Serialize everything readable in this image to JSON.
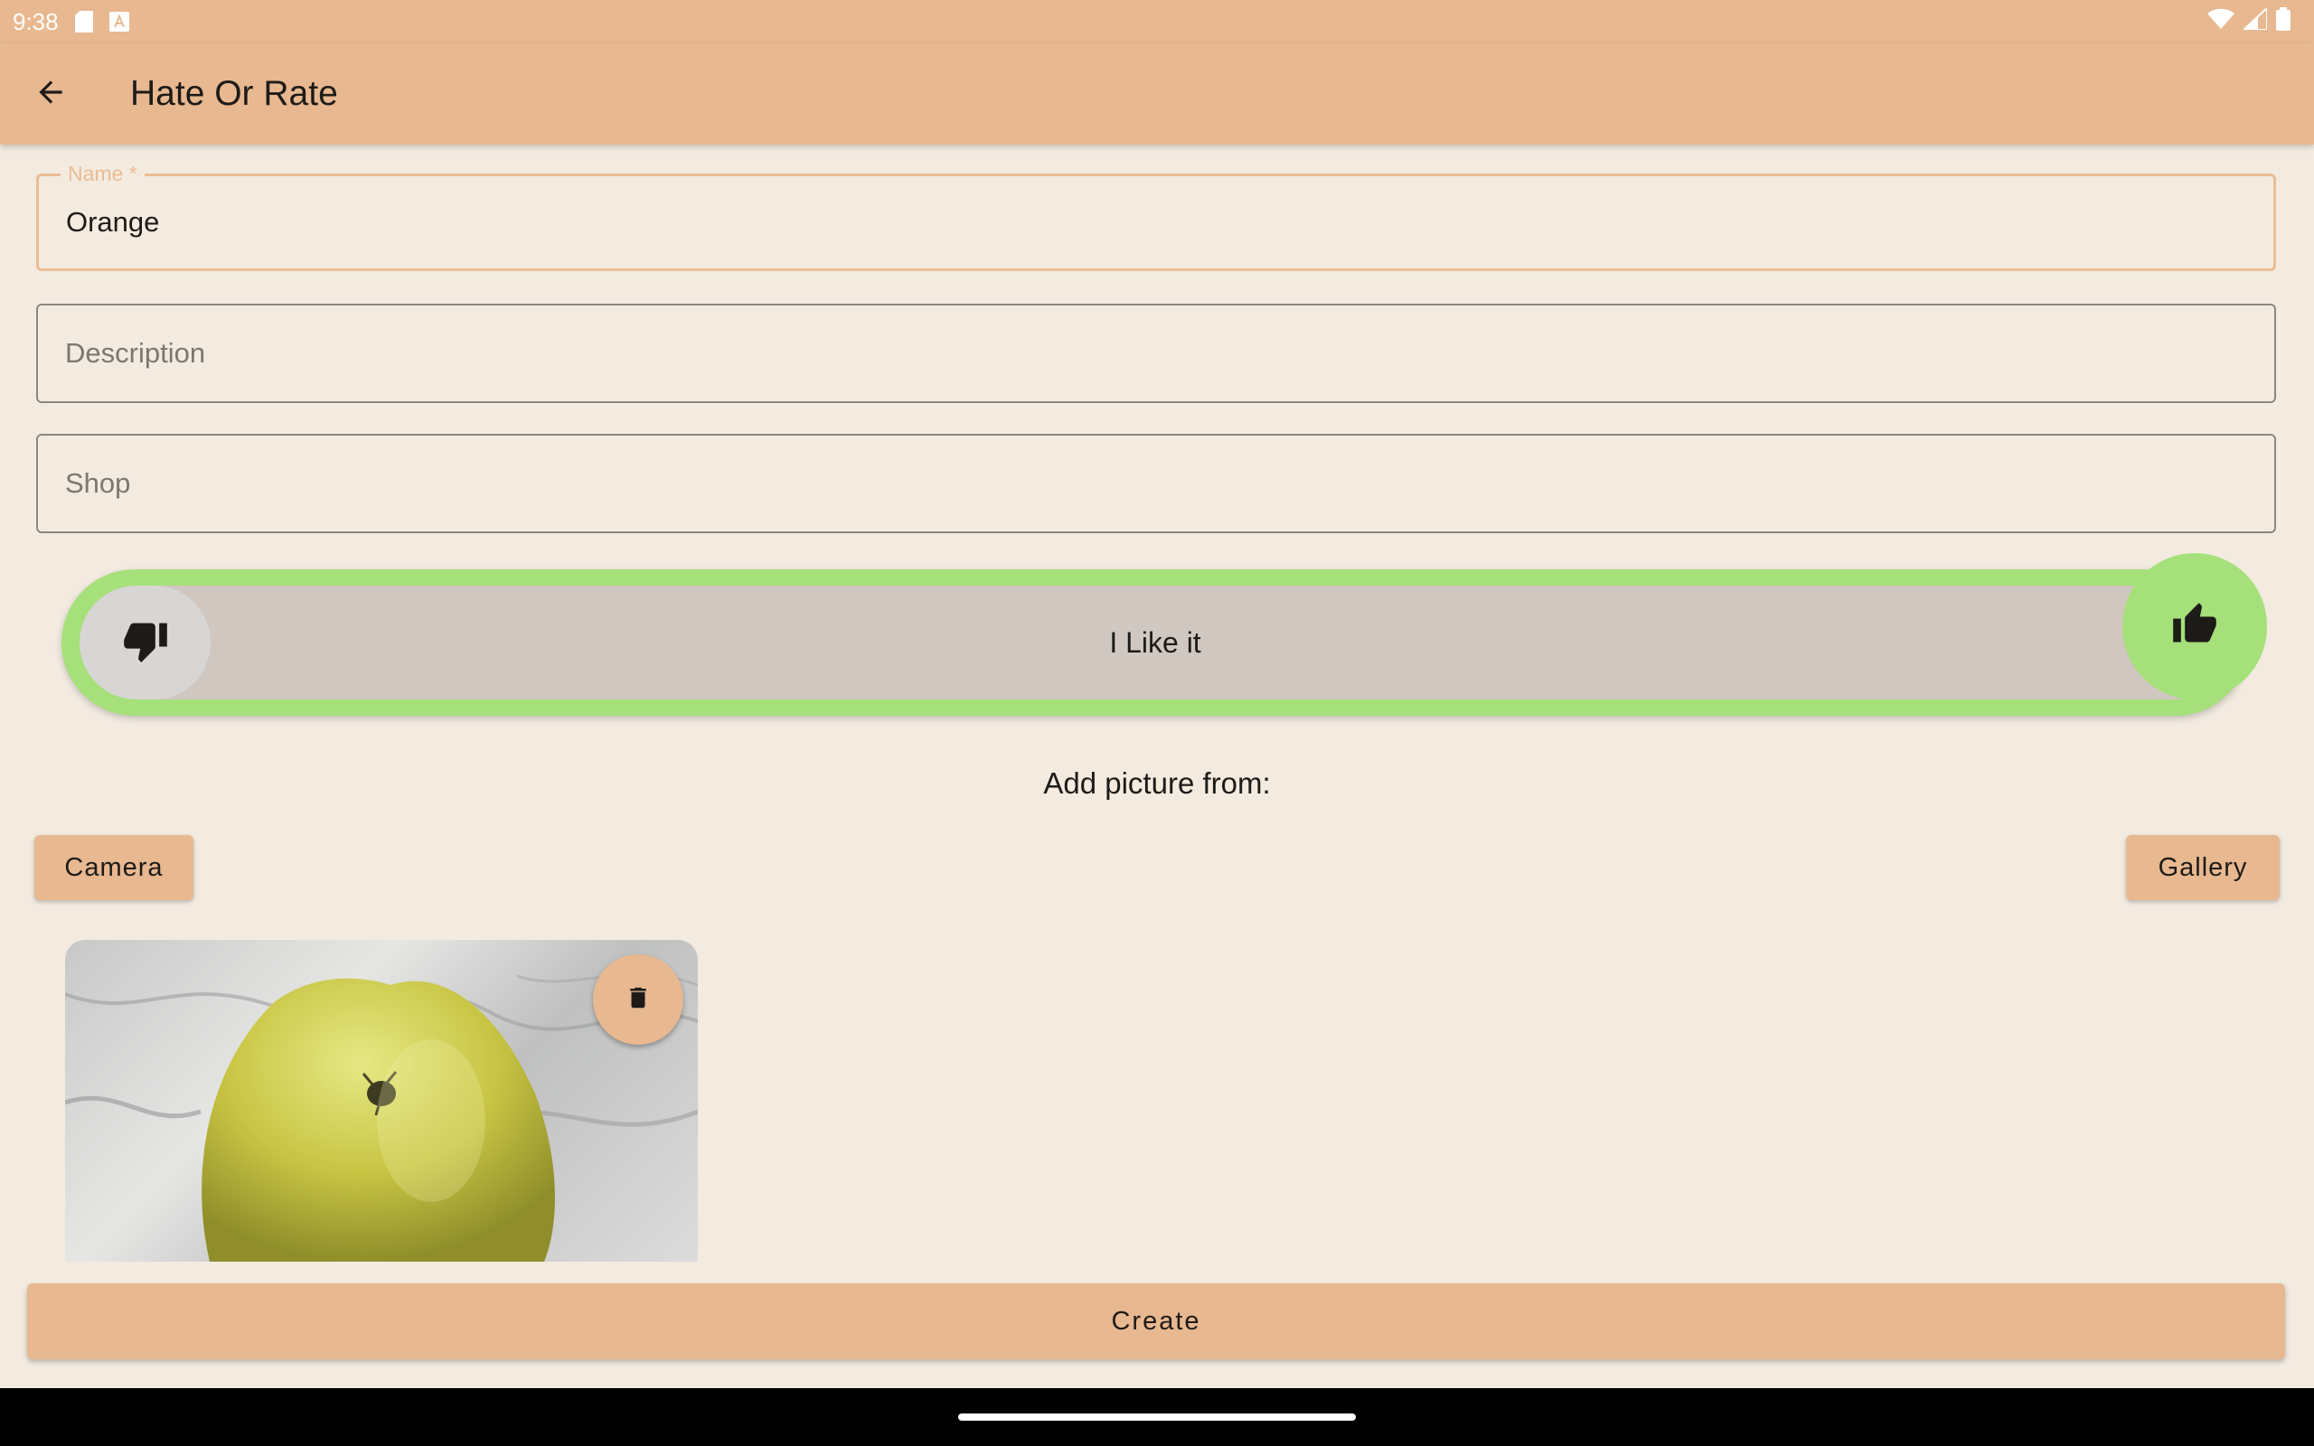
{
  "status_bar": {
    "time": "9:38",
    "left_icons": [
      "sd-card-icon",
      "keyboard-a-icon"
    ],
    "right_icons": [
      "wifi-icon",
      "signal-icon",
      "battery-icon"
    ]
  },
  "app_bar": {
    "back_icon": "arrow-back-icon",
    "title": "Hate Or Rate"
  },
  "form": {
    "name": {
      "label": "Name *",
      "value": "Orange"
    },
    "description": {
      "placeholder": "Description",
      "value": ""
    },
    "shop": {
      "placeholder": "Shop",
      "value": ""
    }
  },
  "rating": {
    "label": "I Like it",
    "dislike_icon": "thumb-down-icon",
    "like_icon": "thumb-up-icon",
    "selected": "like",
    "colors": {
      "like": "#a6e07a",
      "track": "#d0c7c1"
    }
  },
  "picture": {
    "add_label": "Add picture from:",
    "camera_label": "Camera",
    "gallery_label": "Gallery",
    "delete_icon": "trash-icon"
  },
  "actions": {
    "create_label": "Create"
  },
  "theme": {
    "accent": "#e8b890",
    "background": "#f3ebe0"
  }
}
